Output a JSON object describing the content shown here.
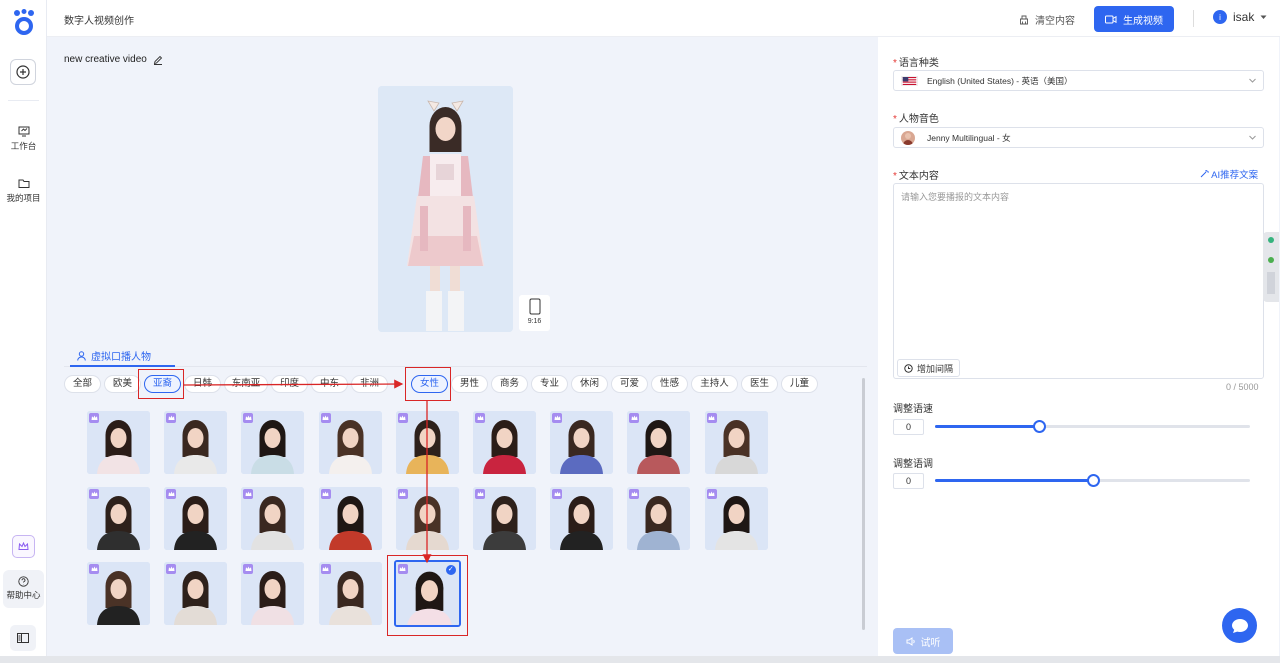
{
  "header": {
    "title": "数字人视频创作",
    "clear_label": "清空内容",
    "generate_label": "生成视频",
    "user_initial": "i",
    "username": "isak"
  },
  "rail": {
    "workspace_label": "工作台",
    "projects_label": "我的项目",
    "help_label": "帮助中心"
  },
  "main": {
    "project_title": "new creative video",
    "ratio_label": "9:16",
    "avatar_tab_label": "虚拟口播人物",
    "filters": [
      "全部",
      "欧美",
      "亚裔",
      "日韩",
      "东南亚",
      "印度",
      "中东",
      "非洲",
      "女性",
      "男性",
      "商务",
      "专业",
      "休闲",
      "可爱",
      "性感",
      "主持人",
      "医生",
      "儿童"
    ],
    "active_filters": [
      "亚裔",
      "女性"
    ],
    "avatar_count": 23,
    "selected_avatar_index": 22,
    "annotation_color": "#d92626"
  },
  "panel": {
    "language_label": "语言种类",
    "language_value": "English (United States) - 英语（美国）",
    "voice_label": "人物音色",
    "voice_value": "Jenny Multilingual - 女",
    "text_label": "文本内容",
    "ai_label": "AI推荐文案",
    "text_placeholder": "请输入您要播报的文本内容",
    "pause_label": "增加间隔",
    "counter": "0 / 5000",
    "speed_label": "调整语速",
    "speed_value": "0",
    "speed_fraction": 0.33,
    "pitch_label": "调整语调",
    "pitch_value": "0",
    "pitch_fraction": 0.5,
    "try_label": "试听"
  },
  "colors": {
    "accent": "#2e66f0",
    "annotation": "#d92626"
  }
}
